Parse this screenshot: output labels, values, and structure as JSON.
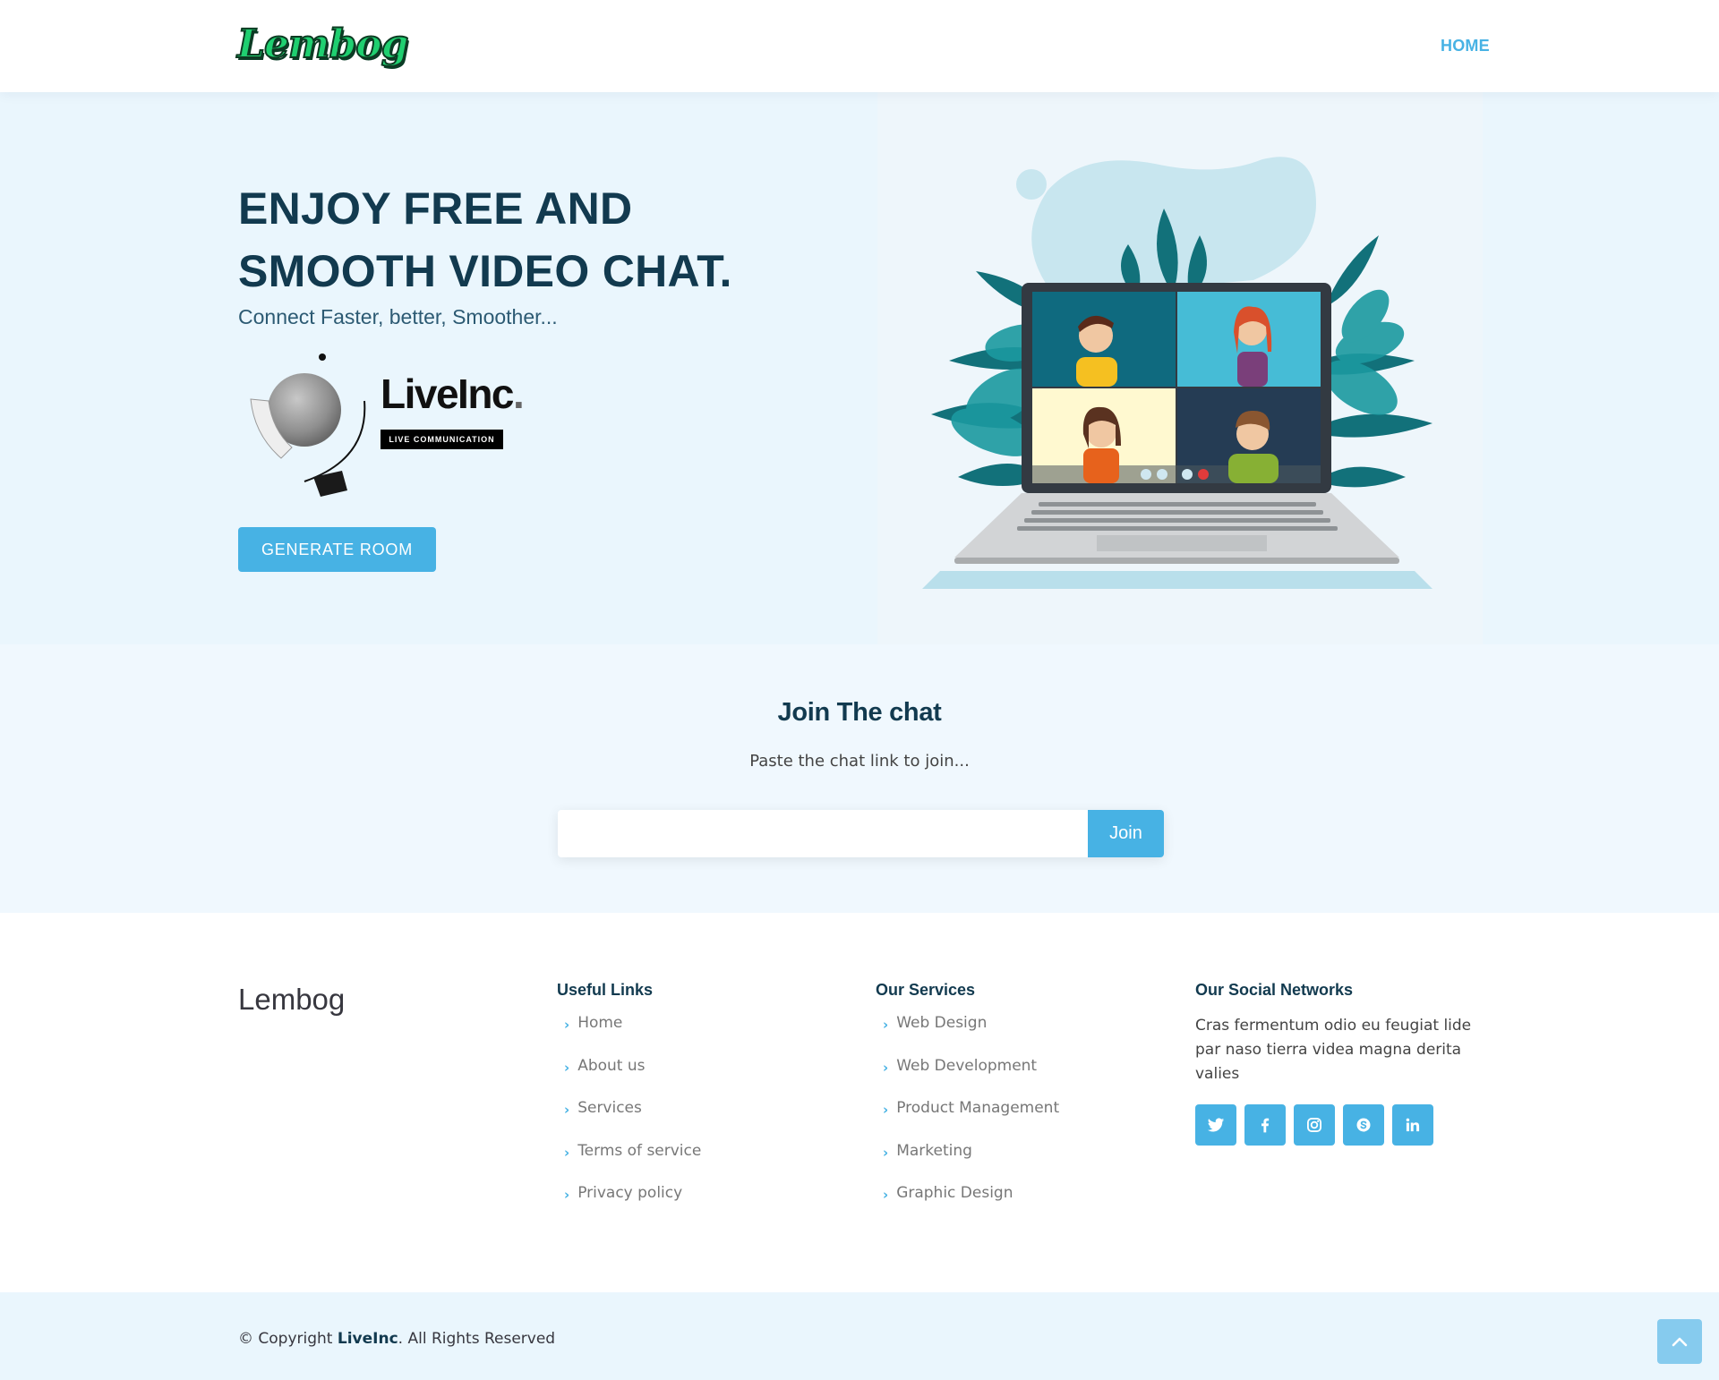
{
  "header": {
    "logo_text": "Lembog",
    "nav": [
      {
        "label": "HOME",
        "active": true
      }
    ]
  },
  "hero": {
    "title": "ENJOY FREE AND SMOOTH VIDEO CHAT.",
    "subtitle": "Connect Faster, better, Smoother...",
    "brand_logo": {
      "name": "LiveInc",
      "tagline": "LIVE COMMUNICATION"
    },
    "generate_button": "GENERATE ROOM",
    "illustration": "laptop-video-call-illustration"
  },
  "join": {
    "title": "Join The chat",
    "description": "Paste the chat link to join...",
    "input_value": "",
    "input_placeholder": "",
    "button": "Join"
  },
  "footer": {
    "brand": "Lembog",
    "useful_links": {
      "heading": "Useful Links",
      "items": [
        "Home",
        "About us",
        "Services",
        "Terms of service",
        "Privacy policy"
      ]
    },
    "services": {
      "heading": "Our Services",
      "items": [
        "Web Design",
        "Web Development",
        "Product Management",
        "Marketing",
        "Graphic Design"
      ]
    },
    "social": {
      "heading": "Our Social Networks",
      "text": "Cras fermentum odio eu feugiat lide par naso tierra videa magna derita valies",
      "icons": [
        "twitter-icon",
        "facebook-icon",
        "instagram-icon",
        "skype-icon",
        "linkedin-icon"
      ]
    },
    "copyright_prefix": "© Copyright ",
    "copyright_brand": "LiveInc",
    "copyright_suffix": ". All Rights Reserved"
  },
  "colors": {
    "accent": "#47b2e4",
    "heading": "#123a4f",
    "hero_bg": "#eaf6fd",
    "logo_green": "#1fcf70"
  }
}
